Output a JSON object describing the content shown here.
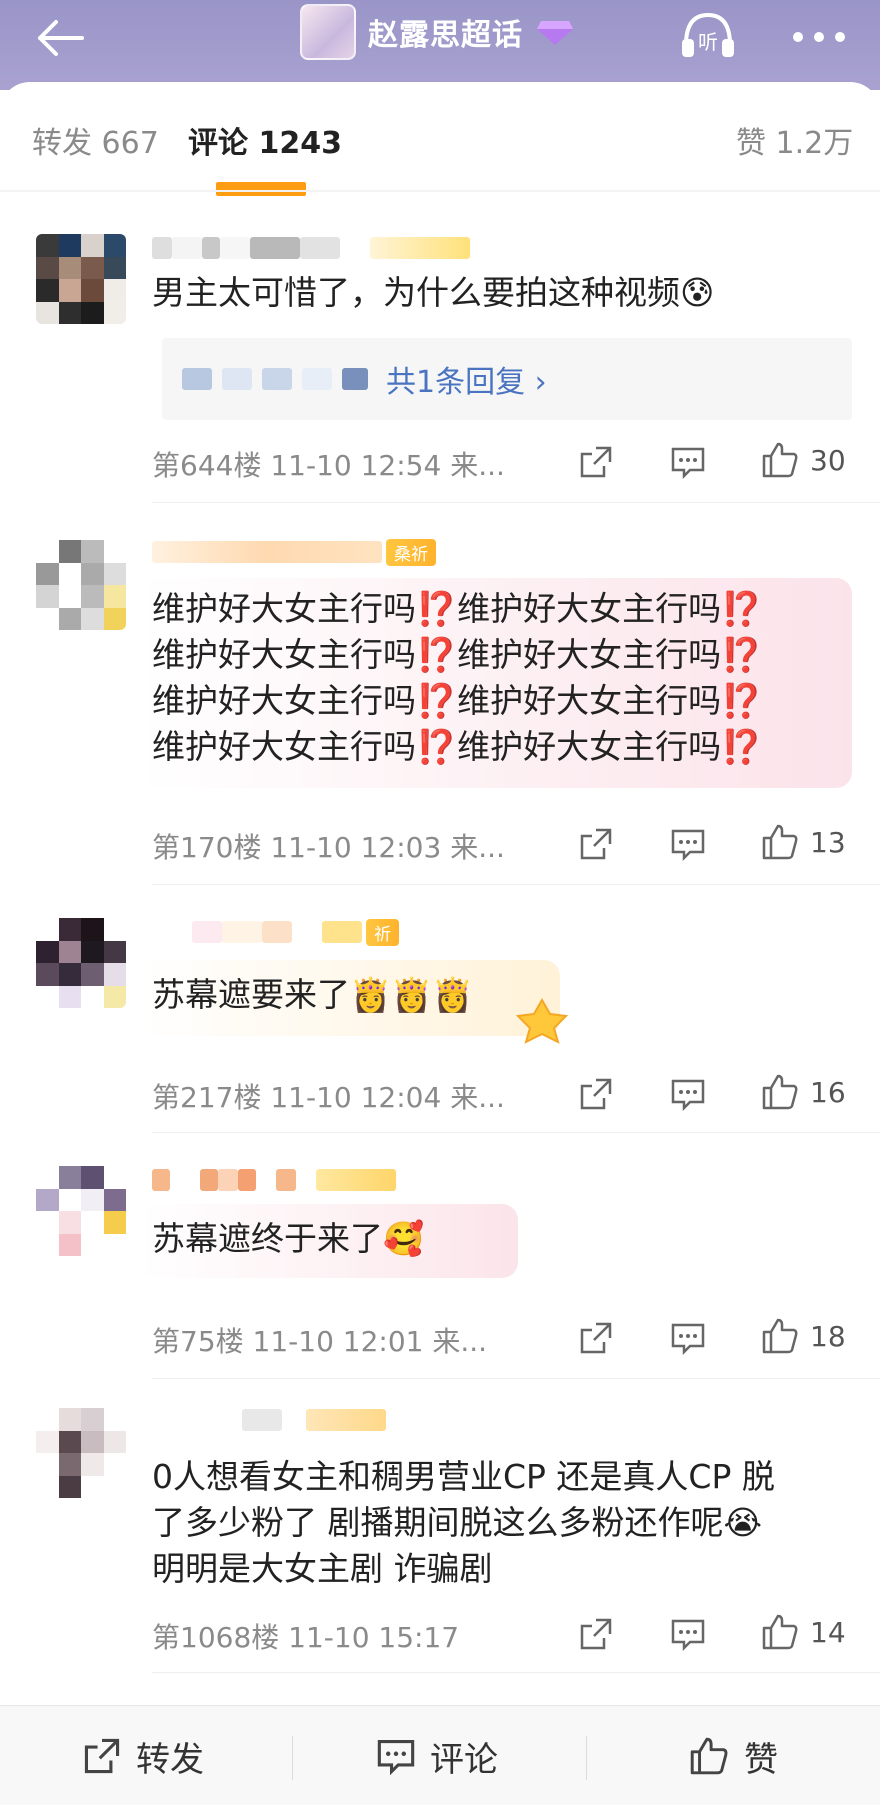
{
  "header": {
    "title": "赵露思超话",
    "back_icon": "back-arrow-icon",
    "listen_label": "听",
    "more_icon": "more-dots-icon",
    "bg_color": "#a19bcc",
    "diamond_color": "#b779ef"
  },
  "tabs": {
    "repost_label": "转发",
    "repost_count": "667",
    "comment_label": "评论",
    "comment_count": "1243",
    "like_label": "赞",
    "like_count": "1.2万",
    "accent": "#ff9d12"
  },
  "comments": [
    {
      "text": "男主太可惜了，为什么要拍这种视频😰",
      "reply_link": "共1条回复 ›",
      "meta": "第644楼 11-10 12:54 来...",
      "likes": "30"
    },
    {
      "badge": "桑祈",
      "lines": [
        "维护好大女主行吗⁉️维护好大女主行吗⁉️",
        "维护好大女主行吗⁉️维护好大女主行吗⁉️",
        "维护好大女主行吗⁉️维护好大女主行吗⁉️",
        "维护好大女主行吗⁉️维护好大女主行吗⁉️"
      ],
      "meta": "第170楼 11-10 12:03 来...",
      "likes": "13"
    },
    {
      "badge": "祈",
      "text": "苏幕遮要来了👸👸👸",
      "meta": "第217楼 11-10 12:04 来...",
      "likes": "16"
    },
    {
      "text": "苏幕遮终于来了🥰",
      "meta": "第75楼 11-10 12:01 来...",
      "likes": "18"
    },
    {
      "lines": [
        "0人想看女主和稠男营业CP 还是真人CP 脱",
        "了多少粉了 剧播期间脱这么多粉还作呢😭",
        "明明是大女主剧 诈骗剧"
      ],
      "meta": "第1068楼 11-10 15:17",
      "likes": "14"
    }
  ],
  "bottom_bar": {
    "repost": "转发",
    "comment": "评论",
    "like": "赞"
  }
}
